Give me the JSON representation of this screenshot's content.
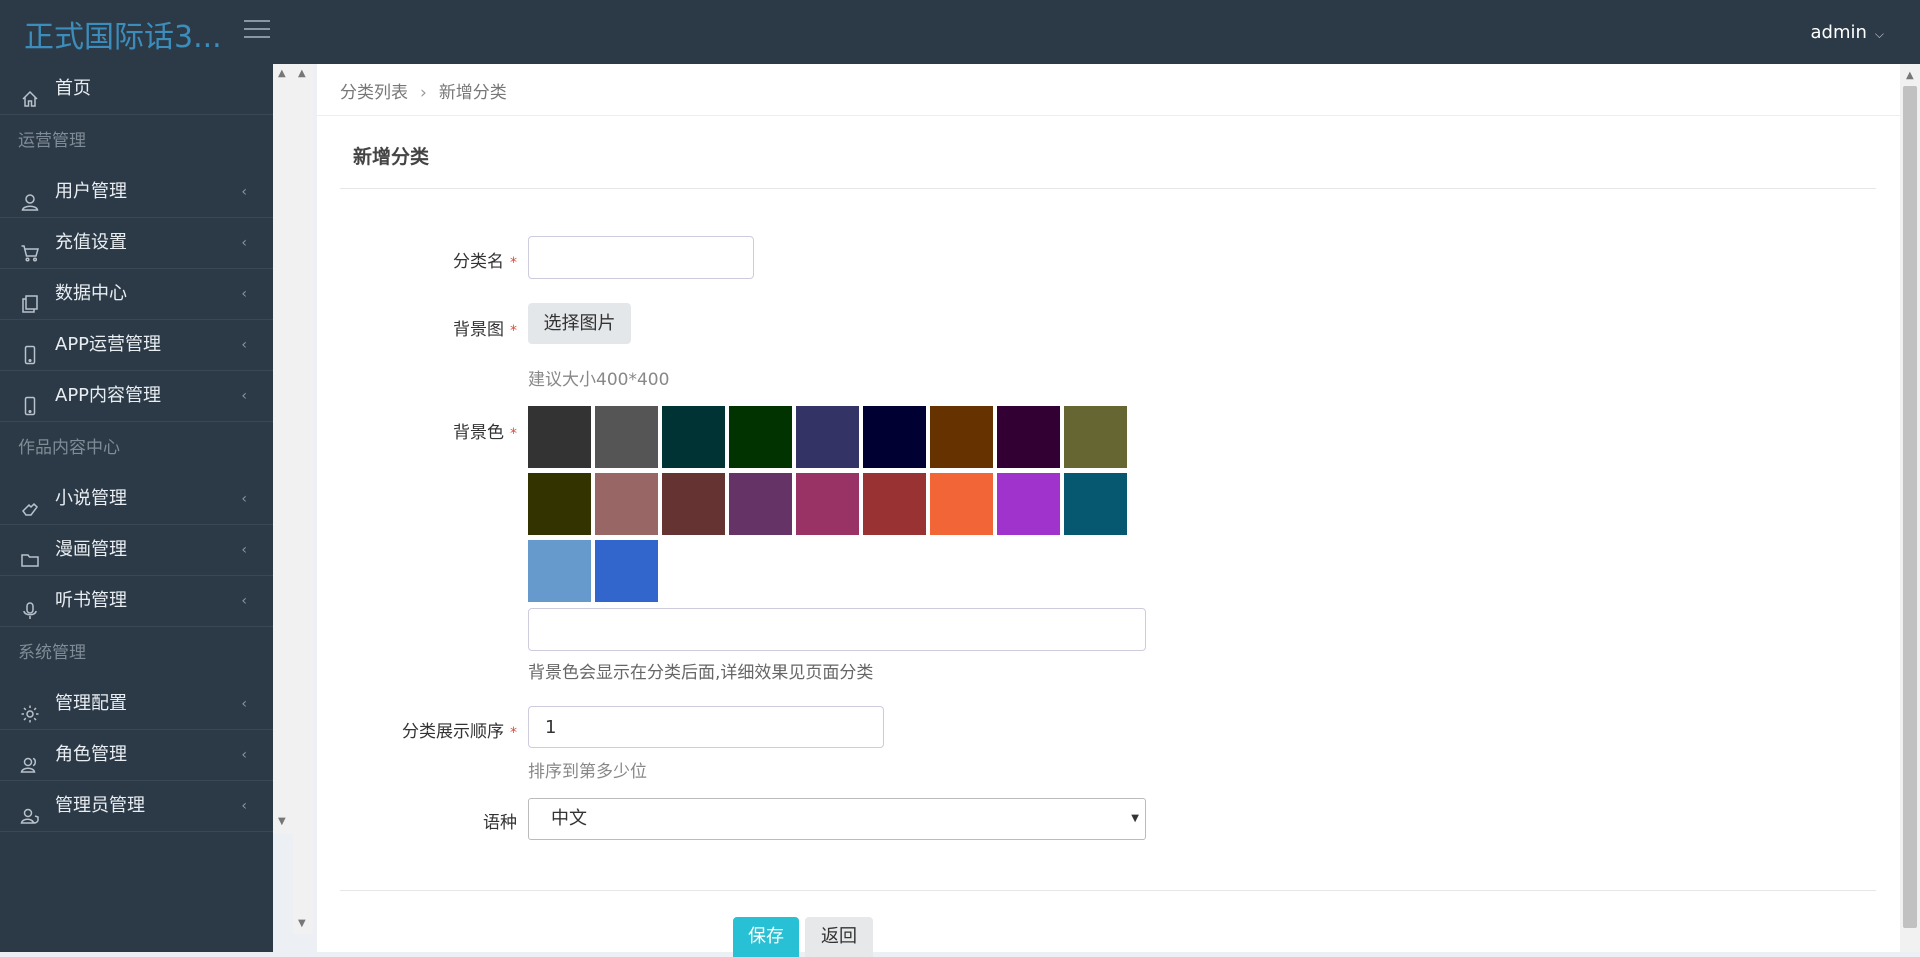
{
  "header": {
    "brand": "正式国际话3...",
    "user": "admin"
  },
  "sidebar": {
    "items": [
      {
        "type": "item",
        "name": "home",
        "icon": "home-icon",
        "label": "首页",
        "chevron": false
      },
      {
        "type": "header",
        "label": "运营管理"
      },
      {
        "type": "item",
        "name": "users",
        "icon": "user-icon",
        "label": "用户管理",
        "chevron": true
      },
      {
        "type": "item",
        "name": "recharge",
        "icon": "cart-icon",
        "label": "充值设置",
        "chevron": true
      },
      {
        "type": "item",
        "name": "data-center",
        "icon": "copy-icon",
        "label": "数据中心",
        "chevron": true
      },
      {
        "type": "item",
        "name": "app-operation",
        "icon": "mobile-icon",
        "label": "APP运营管理",
        "chevron": true
      },
      {
        "type": "item",
        "name": "app-content",
        "icon": "mobile-icon",
        "label": "APP内容管理",
        "chevron": true
      },
      {
        "type": "header",
        "label": "作品内容中心"
      },
      {
        "type": "item",
        "name": "novels",
        "icon": "hand-icon",
        "label": "小说管理",
        "chevron": true
      },
      {
        "type": "item",
        "name": "comics",
        "icon": "folder-icon",
        "label": "漫画管理",
        "chevron": true
      },
      {
        "type": "item",
        "name": "audiobooks",
        "icon": "microphone-icon",
        "label": "听书管理",
        "chevron": true
      },
      {
        "type": "header",
        "label": "系统管理"
      },
      {
        "type": "item",
        "name": "config",
        "icon": "gear-icon",
        "label": "管理配置",
        "chevron": true
      },
      {
        "type": "item",
        "name": "roles",
        "icon": "users-icon",
        "label": "角色管理",
        "chevron": true
      },
      {
        "type": "item",
        "name": "admins",
        "icon": "user-shield-icon",
        "label": "管理员管理",
        "chevron": true
      }
    ]
  },
  "breadcrumb": {
    "parent": "分类列表",
    "current": "新增分类"
  },
  "page": {
    "title": "新增分类"
  },
  "form": {
    "name_label": "分类名",
    "name_value": "",
    "bg_image_label": "背景图",
    "choose_image": "选择图片",
    "bg_image_help": "建议大小400*400",
    "bg_color_label": "背景色",
    "bg_color_value": "",
    "bg_color_help": "背景色会显示在分类后面,详细效果见页面分类",
    "order_label": "分类展示顺序",
    "order_value": "1",
    "order_help": "排序到第多少位",
    "language_label": "语种",
    "language_value": "中文",
    "required_mark": "*"
  },
  "swatches": [
    "#333333",
    "#555555",
    "#003333",
    "#003300",
    "#333366",
    "#000033",
    "#663300",
    "#330033",
    "#666633",
    "#333300",
    "#996666",
    "#663333",
    "#663366",
    "#993366",
    "#993333",
    "#f26536",
    "#9f33cc",
    "#065770",
    "#6699cc",
    "#3366cc"
  ],
  "actions": {
    "save": "保存",
    "back": "返回"
  }
}
